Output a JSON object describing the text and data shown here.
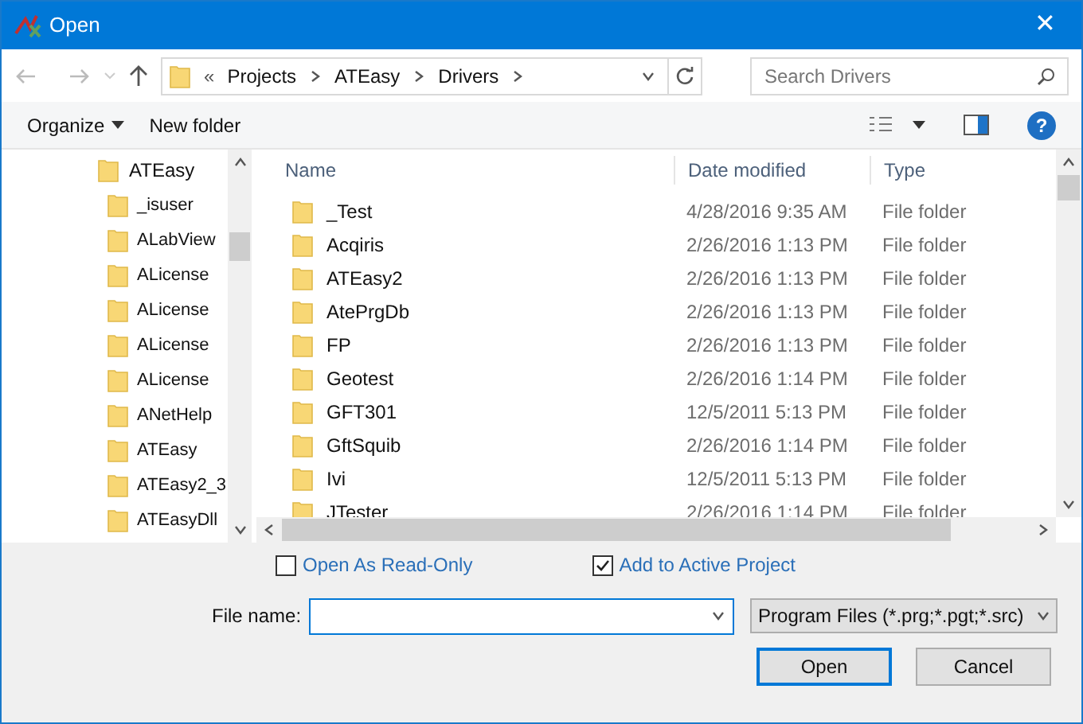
{
  "window": {
    "title": "Open",
    "close": "✕"
  },
  "nav": {
    "breadcrumb_prefix": "«",
    "breadcrumb": [
      "Projects",
      "ATEasy",
      "Drivers"
    ],
    "search": {
      "placeholder": "Search Drivers"
    }
  },
  "toolbar": {
    "organize": "Organize",
    "new_folder": "New folder",
    "help": "?"
  },
  "tree": {
    "root": "ATEasy",
    "children": [
      {
        "label": "_isuser"
      },
      {
        "label": "ALabView"
      },
      {
        "label": "ALicense"
      },
      {
        "label": "ALicense"
      },
      {
        "label": "ALicense"
      },
      {
        "label": "ALicense"
      },
      {
        "label": "ANetHelp"
      },
      {
        "label": "ATEasy"
      },
      {
        "label": "ATEasy2_3"
      },
      {
        "label": "ATEasyDll"
      }
    ]
  },
  "table": {
    "columns": [
      "Name",
      "Date modified",
      "Type"
    ],
    "rows": [
      {
        "name": "_Test",
        "date": "4/28/2016 9:35 AM",
        "type": "File folder"
      },
      {
        "name": "Acqiris",
        "date": "2/26/2016 1:13 PM",
        "type": "File folder"
      },
      {
        "name": "ATEasy2",
        "date": "2/26/2016 1:13 PM",
        "type": "File folder"
      },
      {
        "name": "AtePrgDb",
        "date": "2/26/2016 1:13 PM",
        "type": "File folder"
      },
      {
        "name": "FP",
        "date": "2/26/2016 1:13 PM",
        "type": "File folder"
      },
      {
        "name": "Geotest",
        "date": "2/26/2016 1:14 PM",
        "type": "File folder"
      },
      {
        "name": "GFT301",
        "date": "12/5/2011 5:13 PM",
        "type": "File folder"
      },
      {
        "name": "GftSquib",
        "date": "2/26/2016 1:14 PM",
        "type": "File folder"
      },
      {
        "name": "Ivi",
        "date": "12/5/2011 5:13 PM",
        "type": "File folder"
      },
      {
        "name": "JTester",
        "date": "2/26/2016 1:14 PM",
        "type": "File folder"
      }
    ]
  },
  "options": [
    {
      "label": "Open As Read-Only",
      "checked": false
    },
    {
      "label": "Add to Active Project",
      "checked": true
    }
  ],
  "file_name": {
    "label": "File name:"
  },
  "file_type": "Program Files (*.prg;*.pgt;*.src)",
  "buttons": [
    "Open",
    "Cancel"
  ]
}
